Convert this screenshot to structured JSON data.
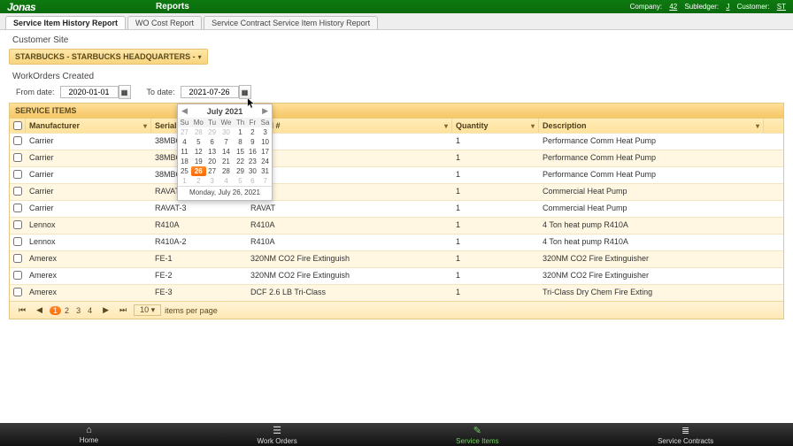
{
  "topbar": {
    "logo": "Jonas",
    "menu": "Reports",
    "right": {
      "company_lbl": "Company:",
      "company_val": "42",
      "sub_lbl": "Subledger:",
      "sub_val": "J",
      "cust_lbl": "Customer:",
      "cust_val": "ST"
    }
  },
  "tabs": [
    {
      "label": "Service Item History Report",
      "active": true
    },
    {
      "label": "WO Cost Report",
      "active": false
    },
    {
      "label": "Service Contract Service Item History Report",
      "active": false
    }
  ],
  "customer_site_label": "Customer Site",
  "customer_site_value": "STARBUCKS - STARBUCKS HEADQUARTERS -",
  "workorders_label": "WorkOrders Created",
  "from_label": "From date:",
  "to_label": "To date:",
  "from_value": "2020-01-01",
  "to_value": "2021-07-26",
  "grid_title": "SERVICE ITEMS",
  "columns": {
    "manu": "Manufacturer",
    "serial": "Serial #",
    "model": "Model #",
    "qty": "Quantity",
    "desc": "Description"
  },
  "rows": [
    {
      "manu": "Carrier",
      "serial": "38MBQ-",
      "model": "",
      "qty": "1",
      "desc": "Performance Comm Heat Pump"
    },
    {
      "manu": "Carrier",
      "serial": "38MBQ-",
      "model": "",
      "qty": "1",
      "desc": "Performance Comm Heat Pump"
    },
    {
      "manu": "Carrier",
      "serial": "38MBQ-",
      "model": "",
      "qty": "1",
      "desc": "Performance Comm Heat Pump"
    },
    {
      "manu": "Carrier",
      "serial": "RAVAT-",
      "model": "",
      "qty": "1",
      "desc": "Commercial Heat Pump"
    },
    {
      "manu": "Carrier",
      "serial": "RAVAT-3",
      "model": "RAVAT",
      "qty": "1",
      "desc": "Commercial Heat Pump"
    },
    {
      "manu": "Lennox",
      "serial": "R410A",
      "model": "R410A",
      "qty": "1",
      "desc": "4 Ton heat pump R410A"
    },
    {
      "manu": "Lennox",
      "serial": "R410A-2",
      "model": "R410A",
      "qty": "1",
      "desc": "4 Ton heat pump R410A"
    },
    {
      "manu": "Amerex",
      "serial": "FE-1",
      "model": "320NM CO2 Fire Extinguish",
      "qty": "1",
      "desc": "320NM CO2 Fire Extinguisher"
    },
    {
      "manu": "Amerex",
      "serial": "FE-2",
      "model": "320NM CO2 Fire Extinguish",
      "qty": "1",
      "desc": "320NM CO2 Fire Extinguisher"
    },
    {
      "manu": "Amerex",
      "serial": "FE-3",
      "model": "DCF 2.6 LB Tri-Class",
      "qty": "1",
      "desc": "Tri-Class Dry Chem Fire Exting"
    }
  ],
  "pager": {
    "pages": [
      "1",
      "2",
      "3",
      "4"
    ],
    "active": 0,
    "perpage_value": "10",
    "perpage_label": "items per page"
  },
  "calendar": {
    "title": "July 2021",
    "dow": [
      "Su",
      "Mo",
      "Tu",
      "We",
      "Th",
      "Fr",
      "Sa"
    ],
    "weeks": [
      [
        {
          "d": "27",
          "dim": true
        },
        {
          "d": "28",
          "dim": true
        },
        {
          "d": "29",
          "dim": true
        },
        {
          "d": "30",
          "dim": true
        },
        {
          "d": "1"
        },
        {
          "d": "2"
        },
        {
          "d": "3"
        }
      ],
      [
        {
          "d": "4"
        },
        {
          "d": "5"
        },
        {
          "d": "6"
        },
        {
          "d": "7"
        },
        {
          "d": "8"
        },
        {
          "d": "9"
        },
        {
          "d": "10"
        }
      ],
      [
        {
          "d": "11"
        },
        {
          "d": "12"
        },
        {
          "d": "13"
        },
        {
          "d": "14"
        },
        {
          "d": "15"
        },
        {
          "d": "16"
        },
        {
          "d": "17"
        }
      ],
      [
        {
          "d": "18"
        },
        {
          "d": "19"
        },
        {
          "d": "20"
        },
        {
          "d": "21"
        },
        {
          "d": "22"
        },
        {
          "d": "23"
        },
        {
          "d": "24"
        }
      ],
      [
        {
          "d": "25"
        },
        {
          "d": "26",
          "sel": true
        },
        {
          "d": "27"
        },
        {
          "d": "28"
        },
        {
          "d": "29"
        },
        {
          "d": "30"
        },
        {
          "d": "31"
        }
      ],
      [
        {
          "d": "1",
          "dim": true
        },
        {
          "d": "2",
          "dim": true
        },
        {
          "d": "3",
          "dim": true
        },
        {
          "d": "4",
          "dim": true
        },
        {
          "d": "5",
          "dim": true
        },
        {
          "d": "6",
          "dim": true
        },
        {
          "d": "7",
          "dim": true
        }
      ]
    ],
    "footer": "Monday, July 26, 2021"
  },
  "bottom_nav": [
    {
      "icon": "⌂",
      "label": "Home"
    },
    {
      "icon": "☰",
      "label": "Work Orders"
    },
    {
      "icon": "✎",
      "label": "Service Items",
      "active": true
    },
    {
      "icon": "≣",
      "label": "Service Contracts"
    }
  ]
}
